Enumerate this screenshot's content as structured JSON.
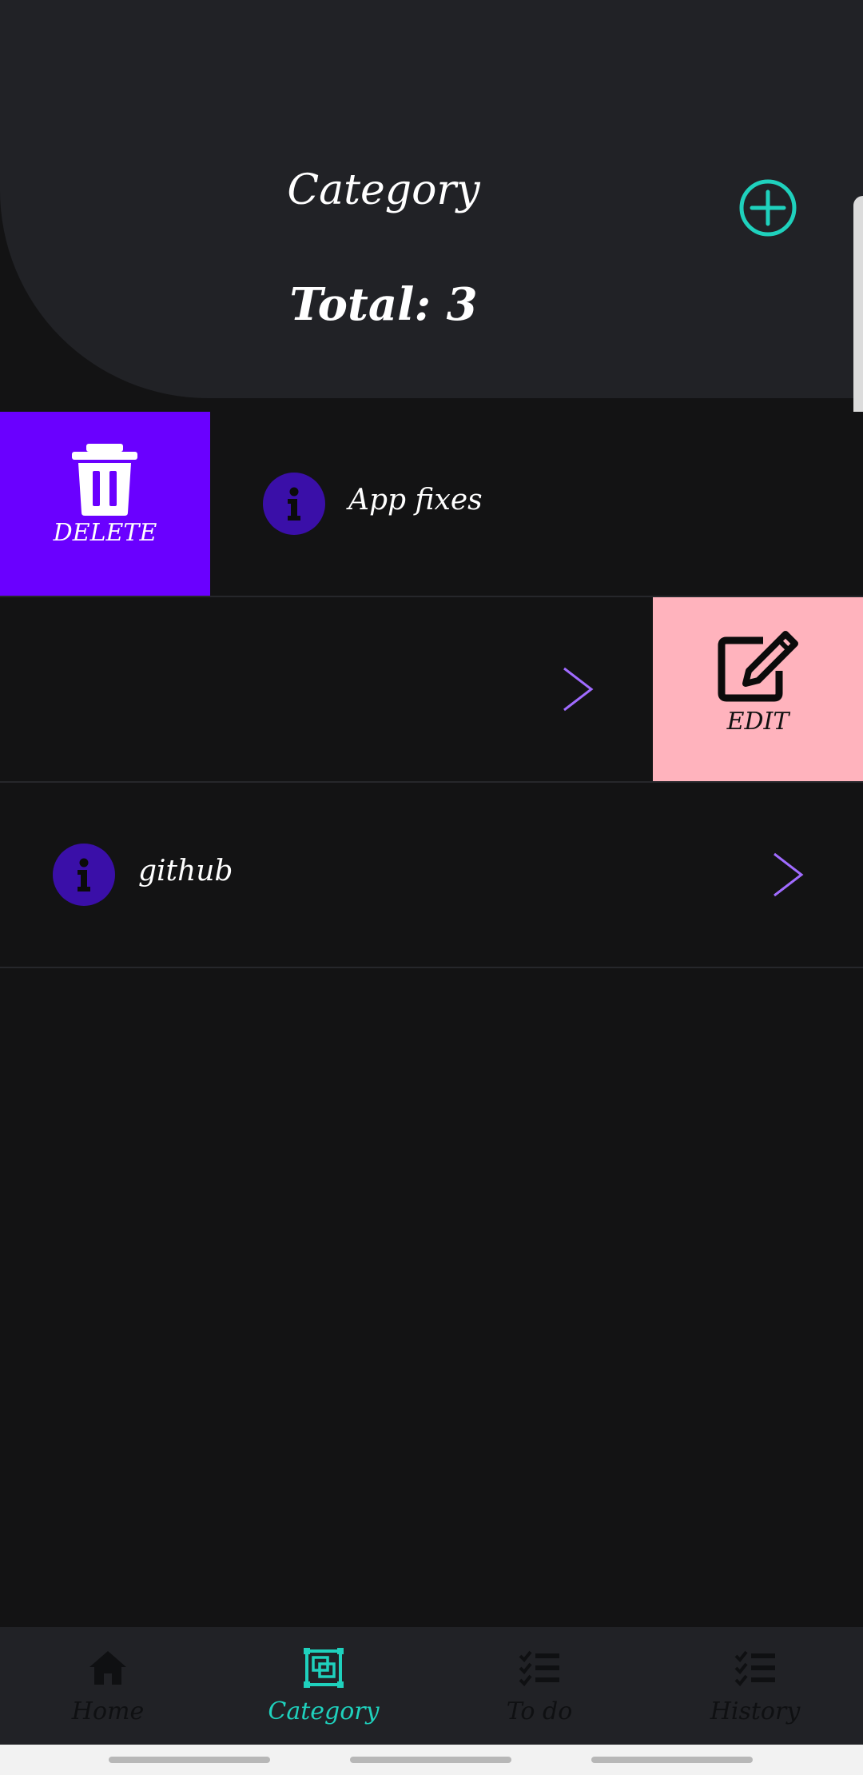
{
  "header": {
    "title": "Category",
    "total": "Total: 3",
    "add_icon": "plus-circle-icon",
    "accent_color": "#1fd1bd"
  },
  "actions": {
    "delete_label": "DELETE",
    "delete_icon": "trash-icon",
    "delete_color": "#6a00ff",
    "edit_label": "EDIT",
    "edit_icon": "edit-icon",
    "edit_color": "#ffb3bd"
  },
  "categories": [
    {
      "name": "App fixes",
      "icon": "info-icon",
      "state": "swiped-right (delete shown)"
    },
    {
      "name": "",
      "icon": "info-icon",
      "state": "swiped-left (edit shown)"
    },
    {
      "name": "github",
      "icon": "info-icon",
      "state": "normal"
    }
  ],
  "bottom_nav": {
    "items": [
      {
        "label": "Home",
        "icon": "home-icon",
        "active": false
      },
      {
        "label": "Category",
        "icon": "category-icon",
        "active": true
      },
      {
        "label": "To do",
        "icon": "checklist-icon",
        "active": false
      },
      {
        "label": "History",
        "icon": "checklist-icon",
        "active": false
      }
    ]
  }
}
